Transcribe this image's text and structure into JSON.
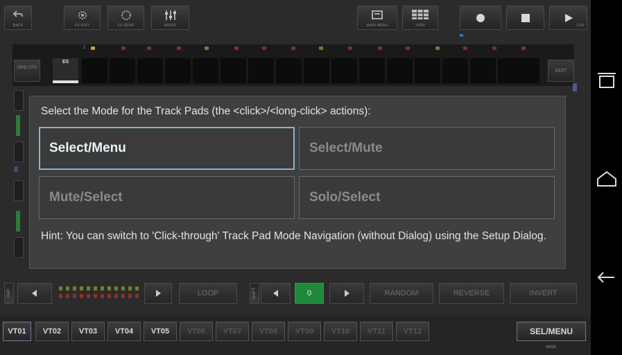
{
  "toolbar": {
    "back_label": "BACK",
    "fx_edit_label": "FX EDIT",
    "fx_send_label": "FX SEND",
    "mixer_label": "MIXER",
    "main_menu_label": "MAIN MENU",
    "view_label": "VIEW",
    "record_icon": "record-icon",
    "stop_icon": "stop-icon",
    "play_label": "CUE"
  },
  "grid": {
    "cfg_label": "GRID CFG",
    "first_cell_label": "ES",
    "edit_label": "EDIT",
    "marker_label": "1"
  },
  "dialog": {
    "title": "Select the Mode for the Track Pads (the <click>/<long-click> actions):",
    "options": [
      {
        "label": "Select/Menu",
        "selected": true
      },
      {
        "label": "Select/Mute",
        "selected": false
      },
      {
        "label": "Mute/Select",
        "selected": false
      },
      {
        "label": "Solo/Select",
        "selected": false
      }
    ],
    "hint": "Hint: You can switch to 'Click-through' Track Pad Mode Navigation (without Dialog) using the Setup Dialog."
  },
  "bottom_bar": {
    "bar_label": "BAR",
    "loop_label": "LOOP",
    "shift_label": "SHIFT",
    "shift_value": "0",
    "random_label": "RANDOM",
    "reverse_label": "REVERSE",
    "invert_label": "INVERT"
  },
  "tracks": {
    "items": [
      "VT01",
      "VT02",
      "VT03",
      "VT04",
      "VT05",
      "VT06",
      "VT07",
      "VT08",
      "VT09",
      "VT10",
      "VT11",
      "VT12"
    ],
    "mode_button_label": "SEL/MENU",
    "mode_caption": "MODE"
  },
  "colors": {
    "accent_selected_border": "#87b5cf",
    "shift_value_bg": "#1f8a3a",
    "app_background": "#2b2b2b",
    "dialog_background": "#3f3f3f"
  }
}
